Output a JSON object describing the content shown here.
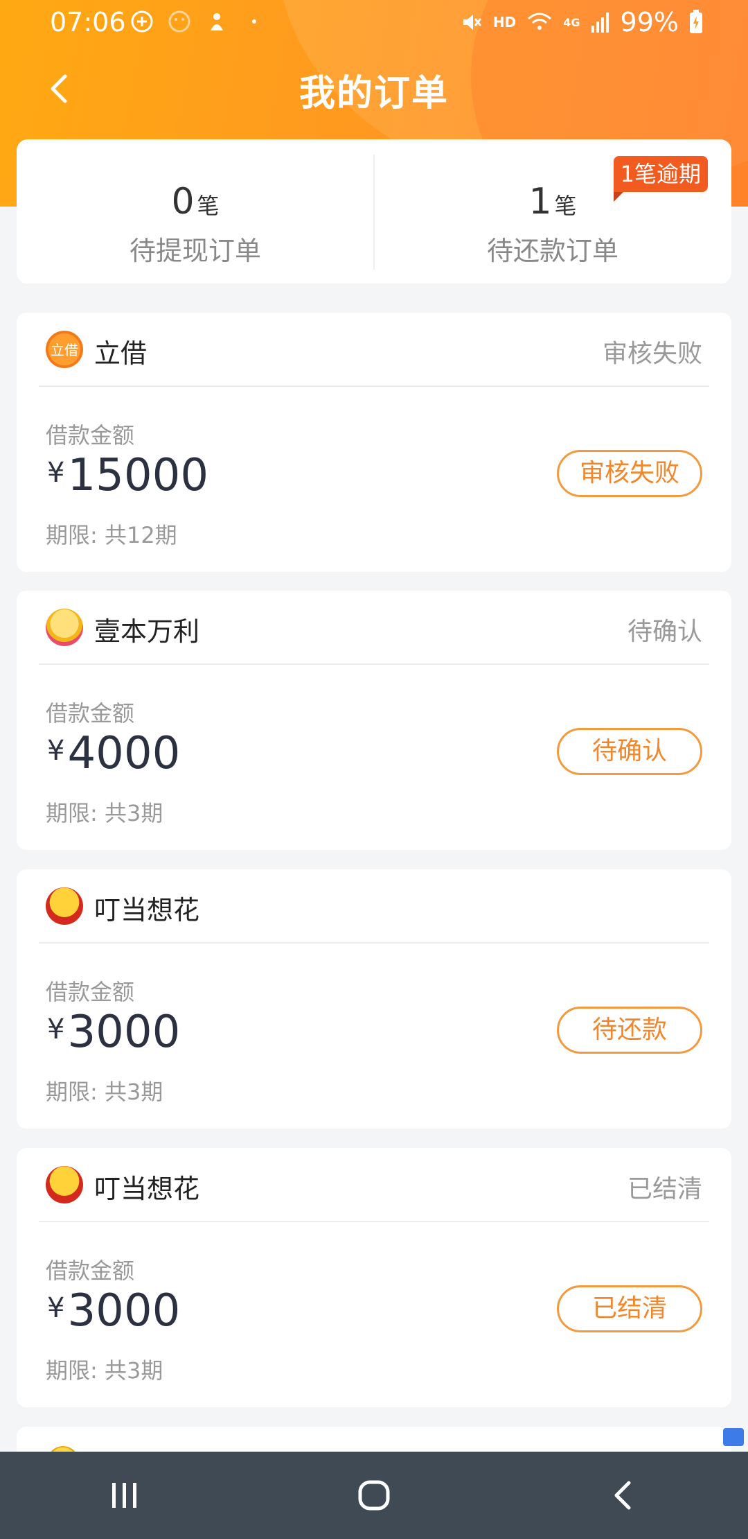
{
  "status_bar": {
    "time": "07:06",
    "battery": "99%",
    "network": "4G",
    "hd": "HD",
    "icons": [
      "add-circle-icon",
      "smiley-icon",
      "android-icon",
      "dot-icon",
      "mute-icon",
      "wifi-icon",
      "signal-icon",
      "battery-charging-icon"
    ]
  },
  "header": {
    "title": "我的订单",
    "back_icon": "chevron-left-icon"
  },
  "summary": {
    "pending_withdraw": {
      "count": "0",
      "unit": "笔",
      "label": "待提现订单"
    },
    "pending_repay": {
      "count": "1",
      "unit": "笔",
      "label": "待还款订单",
      "badge": "1笔逾期"
    }
  },
  "orders": [
    {
      "lender": "立借",
      "status_text": "审核失败",
      "amount_label": "借款金额",
      "currency": "¥",
      "amount": "15000",
      "term": "期限: 共12期",
      "button_label": "审核失败"
    },
    {
      "lender": "壹本万利",
      "status_text": "待确认",
      "amount_label": "借款金额",
      "currency": "¥",
      "amount": "4000",
      "term": "期限: 共3期",
      "button_label": "待确认"
    },
    {
      "lender": "叮当想花",
      "status_text": "",
      "amount_label": "借款金额",
      "currency": "¥",
      "amount": "3000",
      "term": "期限: 共3期",
      "button_label": "待还款"
    },
    {
      "lender": "叮当想花",
      "status_text": "已结清",
      "amount_label": "借款金额",
      "currency": "¥",
      "amount": "3000",
      "term": "期限: 共3期",
      "button_label": "已结清"
    }
  ],
  "nav": {
    "buttons": [
      "recent-apps-icon",
      "home-icon",
      "back-icon"
    ]
  },
  "colors": {
    "accent": "#ff9a1f",
    "badge": "#f25b1f",
    "pill_border": "#f29a3d",
    "navbar": "#3f4a55"
  }
}
